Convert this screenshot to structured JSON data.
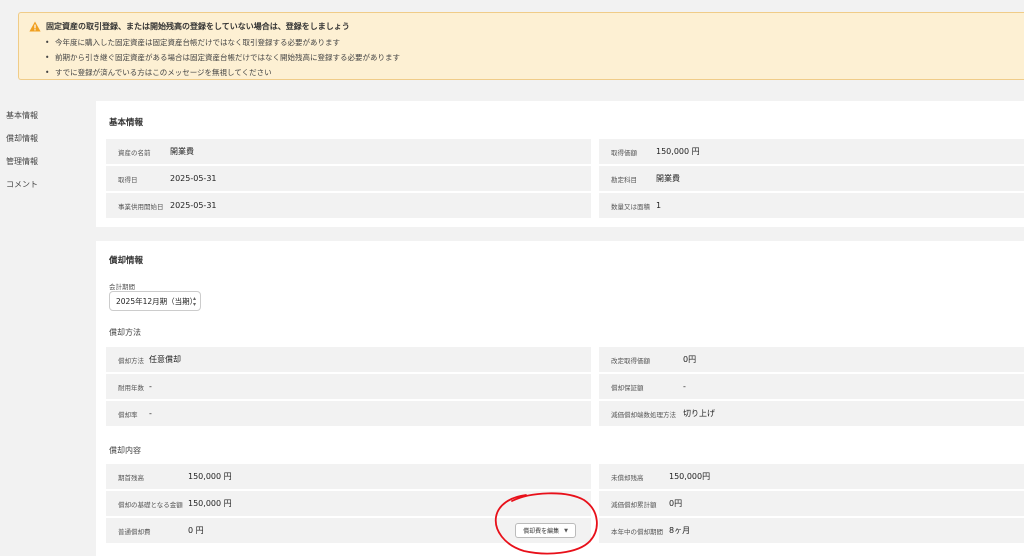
{
  "alert": {
    "title": "固定資産の取引登録、または開始残高の登録をしていない場合は、登録をしましょう",
    "items": [
      "今年度に購入した固定資産は固定資産台帳だけではなく取引登録する必要があります",
      "前期から引き継ぐ固定資産がある場合は固定資産台帳だけではなく開始残高に登録する必要があります",
      "すでに登録が済んでいる方はこのメッセージを無視してください"
    ]
  },
  "nav": [
    "基本情報",
    "償却情報",
    "管理情報",
    "コメント"
  ],
  "basic": {
    "title": "基本情報",
    "left": [
      {
        "label": "資産の名前",
        "value": "開業費"
      },
      {
        "label": "取得日",
        "value": "2025-05-31"
      },
      {
        "label": "事業供用開始日",
        "value": "2025-05-31"
      }
    ],
    "right": [
      {
        "label": "取得価額",
        "value": "150,000 円"
      },
      {
        "label": "勘定科目",
        "value": "開業費"
      },
      {
        "label": "数量又は面積",
        "value": "1"
      }
    ]
  },
  "depreciation": {
    "title": "償却情報",
    "period_label": "会計期間",
    "period_value": "2025年12月期（当期）",
    "method_title": "償却方法",
    "method_left": [
      {
        "label": "償却方法",
        "value": "任意償却"
      },
      {
        "label": "耐用年数",
        "value": "-"
      },
      {
        "label": "償却率",
        "value": "-"
      }
    ],
    "method_right": [
      {
        "label": "改定取得価額",
        "value": "0円"
      },
      {
        "label": "償却保証額",
        "value": "-"
      },
      {
        "label": "減価償却端数処理方法",
        "value": "切り上げ"
      }
    ],
    "content_title": "償却内容",
    "content_left": [
      {
        "label": "期首残高",
        "value": "150,000 円"
      },
      {
        "label": "償却の基礎となる金額",
        "value": "150,000 円"
      },
      {
        "label": "普通償却費",
        "value": "0 円"
      }
    ],
    "content_right": [
      {
        "label": "未償却残高",
        "value": "150,000円"
      },
      {
        "label": "減価償却累計額",
        "value": "0円"
      },
      {
        "label": "本年中の償却期間",
        "value": "8ヶ月"
      }
    ],
    "edit_button": "償却費を編集"
  },
  "icons": {
    "alert": "warning-icon",
    "select": "select-arrows-icon",
    "button": "chevron-down-icon"
  },
  "colors": {
    "alert_bg": "#fdf0d3",
    "alert_border": "#f0cc88",
    "warning": "#f0a020",
    "annotation": "#e8101a"
  }
}
